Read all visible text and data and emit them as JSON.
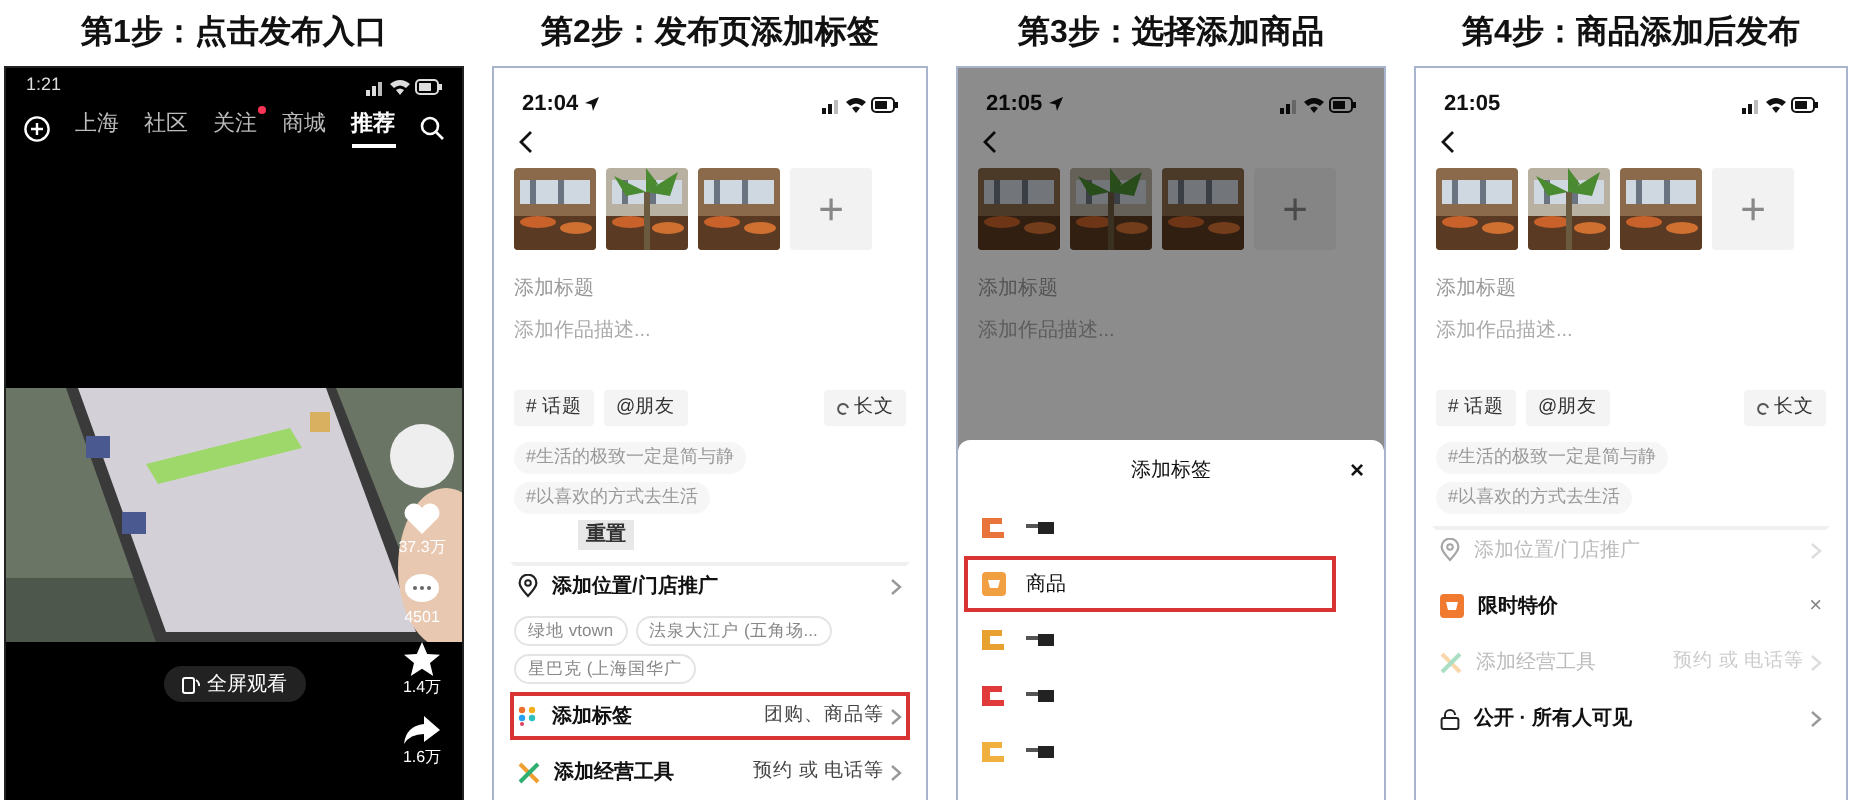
{
  "steps": [
    {
      "kind": "feed",
      "title": "第1步：点击发布入口",
      "time": "1:21",
      "tabs": [
        {
          "label": "上海",
          "selected": false,
          "badge": false
        },
        {
          "label": "社区",
          "selected": false,
          "badge": false
        },
        {
          "label": "关注",
          "selected": false,
          "badge": true
        },
        {
          "label": "商城",
          "selected": false,
          "badge": false
        },
        {
          "label": "推荐",
          "selected": true,
          "badge": false
        }
      ],
      "fullscreen_button": "全屏观看",
      "actions": [
        {
          "kind": "like",
          "count": "37.3万"
        },
        {
          "kind": "comment",
          "count": "4501"
        },
        {
          "kind": "star",
          "count": "1.4万"
        },
        {
          "kind": "share",
          "count": "1.6万"
        }
      ]
    },
    {
      "kind": "publish",
      "title": "第2步：发布页添加标签",
      "time": "21:04",
      "location_arrow": true,
      "add_tile": "+",
      "title_placeholder": "添加标题",
      "description_placeholder": "添加作品描述...",
      "chips": [
        {
          "kind": "topic",
          "label": "# 话题"
        },
        {
          "kind": "mention",
          "label": "@朋友"
        },
        {
          "kind": "long",
          "label": "长文"
        }
      ],
      "suggestions": [
        "#生活的极致一定是简与静",
        "#以喜欢的方式去生活"
      ],
      "tooltip": "重置",
      "rows": [
        {
          "kind": "location",
          "label": "添加位置/门店推广",
          "disabled": false,
          "highlighted": false,
          "chips": [
            "绿地 vtown",
            "法泉大江户 (五角场...",
            "星巴克 (上海国华广"
          ]
        },
        {
          "kind": "tag",
          "label": "添加标签",
          "value": "团购、商品等",
          "disabled": false,
          "highlighted": true
        },
        {
          "kind": "tools",
          "label": "添加经营工具",
          "value": "预约 或 电话等",
          "disabled": false,
          "highlighted": false
        }
      ]
    },
    {
      "kind": "sheet",
      "title": "第3步：选择添加商品",
      "time": "21:05",
      "location_arrow": true,
      "add_tile": "+",
      "title_placeholder": "添加标题",
      "description_placeholder": "添加作品描述...",
      "sheet": {
        "title": "添加标签",
        "close": "×",
        "items": [
          {
            "kind": "redacted",
            "color": "#e8743b",
            "highlighted": false
          },
          {
            "kind": "item",
            "label": "商品",
            "color": "#f0a040",
            "highlighted": true
          },
          {
            "kind": "redacted",
            "color": "#e8a030",
            "highlighted": false
          },
          {
            "kind": "redacted",
            "color": "#e03a3a",
            "highlighted": false
          },
          {
            "kind": "redacted",
            "color": "#f0b040",
            "highlighted": false
          }
        ]
      }
    },
    {
      "kind": "publish",
      "title": "第4步：商品添加后发布",
      "time": "21:05",
      "location_arrow": false,
      "add_tile": "+",
      "title_placeholder": "添加标题",
      "description_placeholder": "添加作品描述...",
      "chips": [
        {
          "kind": "topic",
          "label": "# 话题"
        },
        {
          "kind": "mention",
          "label": "@朋友"
        },
        {
          "kind": "long",
          "label": "长文"
        }
      ],
      "suggestions": [
        "#生活的极致一定是简与静",
        "#以喜欢的方式去生活"
      ],
      "rows": [
        {
          "kind": "location",
          "label": "添加位置/门店推广",
          "disabled": true,
          "highlighted": false
        },
        {
          "kind": "deal",
          "label": "限时特价",
          "close": "×",
          "disabled": false,
          "highlighted": false
        },
        {
          "kind": "tools",
          "label": "添加经营工具",
          "value": "预约 或 电话等",
          "disabled": true,
          "highlighted": false
        },
        {
          "kind": "visibility",
          "label": "公开 · 所有人可见",
          "disabled": false,
          "highlighted": false
        }
      ]
    }
  ]
}
